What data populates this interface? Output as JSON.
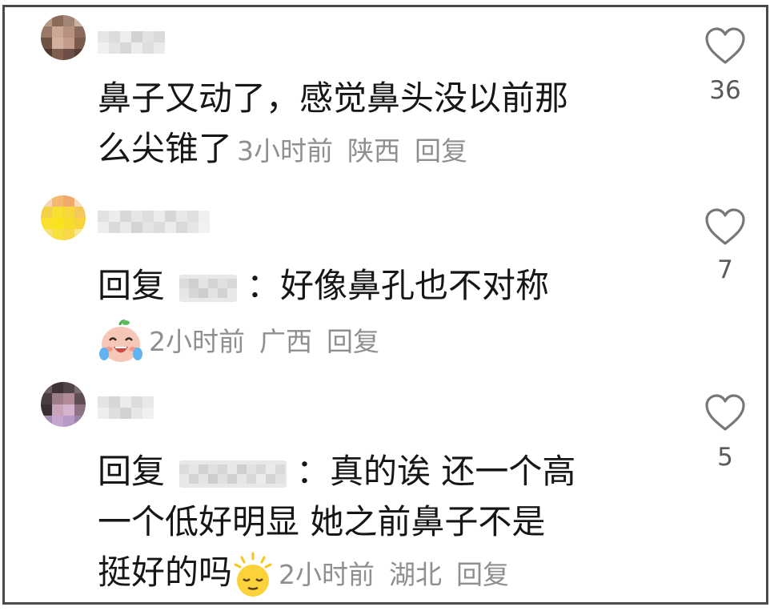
{
  "comments": [
    {
      "text_lines": [
        "鼻子又动了，感觉鼻头没以前那",
        "么尖锥了"
      ],
      "time": "3小时前",
      "location": "陕西",
      "reply_label": "回复",
      "likes": "36"
    },
    {
      "prefix": "回复",
      "colon": "：",
      "body": "好像鼻孔也不对称",
      "emoji": "crying-laughing-face",
      "time": "2小时前",
      "location": "广西",
      "reply_label": "回复",
      "likes": "7"
    },
    {
      "prefix": "回复",
      "colon": "：",
      "line1_body": "真的诶 还一个高",
      "line2": "一个低好明显 她之前鼻子不是",
      "line3": "挺好的吗",
      "emoji": "sleepy-sun-face",
      "time": "2小时前",
      "location": "湖北",
      "reply_label": "回复",
      "likes": "5"
    }
  ],
  "colors": {
    "text": "#161616",
    "meta": "#8f8f8f",
    "heart_stroke": "#777777",
    "border": "#4a4a4a"
  }
}
